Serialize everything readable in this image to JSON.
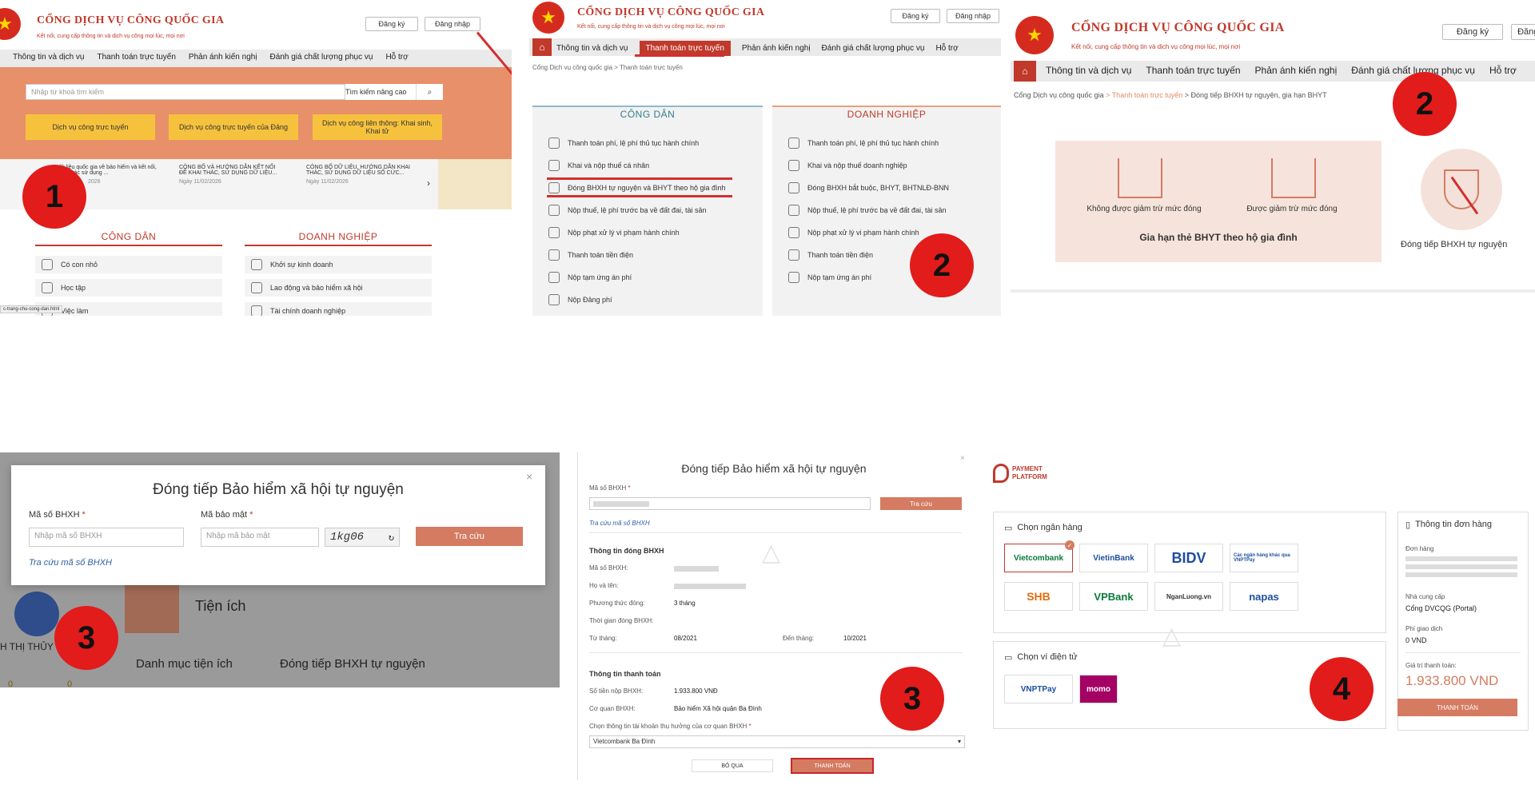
{
  "colors": {
    "brand": "#c0392b",
    "callout": "#e21b1b",
    "accent": "#d47b62"
  },
  "portal": {
    "title": "CỔNG DỊCH VỤ CÔNG QUỐC GIA",
    "subtitle": "Kết nối, cung cấp thông tin và dịch vụ công mọi lúc, mọi nơi",
    "register": "Đăng ký",
    "login": "Đăng nhập",
    "nav": [
      "Thông tin và dịch vụ",
      "Thanh toán trực tuyến",
      "Phản ánh kiến nghị",
      "Đánh giá chất lượng phục vụ",
      "Hỗ trợ"
    ]
  },
  "p1": {
    "search_placeholder": "Nhập từ khoá tìm kiếm",
    "advanced": "Tìm kiếm nâng cao",
    "quick": [
      "Dịch vụ công trực tuyến",
      "Dịch vụ công trực tuyến của Đảng",
      "Dịch vụ công liên thông: Khai sinh, Khai tử"
    ],
    "news": [
      {
        "title": "dữ liệu quốc gia về bảo hiểm và kết nối, khai thác sử dụng ...",
        "date": "2026"
      },
      {
        "title": "CÔNG BỐ VÀ HƯỚNG DẪN KẾT NỐI ĐỂ KHAI THÁC, SỬ DỤNG DỮ LIỆU...",
        "date": "Ngày 11/02/2026"
      },
      {
        "title": "CÔNG BỐ DỮ LIỆU, HƯỚNG DẪN KHAI THÁC, SỬ DỤNG DỮ LIỆU SỐ CỨC...",
        "date": "Ngày 11/02/2026"
      }
    ],
    "citizen": "CÔNG DÂN",
    "business": "DOANH NGHIỆP",
    "citizen_items": [
      "Có con nhỏ",
      "Học tập",
      "Việc làm"
    ],
    "business_items": [
      "Khởi sự kinh doanh",
      "Lao động và bảo hiểm xã hội",
      "Tài chính doanh nghiệp"
    ],
    "status_url": "c-trang-chu-cong-dan.html",
    "callout": "1"
  },
  "p2": {
    "breadcrumb": "Cổng Dịch vụ công quốc gia  >  Thanh toán trực tuyến",
    "citizen": "CÔNG DÂN",
    "business": "DOANH NGHIỆP",
    "citizen_items": [
      "Thanh toán phí, lệ phí thủ tục hành chính",
      "Khai và nộp thuế cá nhân",
      "Đóng BHXH tự nguyện và BHYT theo hộ gia đình",
      "Nộp thuế, lệ phí trước bạ về đất đai, tài sản",
      "Nộp phạt xử lý vi phạm hành chính",
      "Thanh toán tiền điện",
      "Nộp tạm ứng án phí",
      "Nộp Đảng phí"
    ],
    "business_items": [
      "Thanh toán phí, lệ phí thủ tục hành chính",
      "Khai và nộp thuế doanh nghiệp",
      "Đóng BHXH bắt buộc, BHYT, BHTNLĐ-BNN",
      "Nộp thuế, lệ phí trước bạ về đất đai, tài sản",
      "Nộp phạt xử lý vi phạm hành chính",
      "Thanh toán tiền điện",
      "Nộp tạm ứng án phí"
    ],
    "callout": "2"
  },
  "p3": {
    "breadcrumb_home": "Cổng Dịch vụ công quốc gia",
    "breadcrumb_mid": "Thanh toán trực tuyến",
    "breadcrumb_last": "Đóng tiếp BHXH tự nguyện, gia hạn BHYT",
    "opt1": "Không được giảm trừ mức đóng",
    "opt2": "Được giảm trừ mức đóng",
    "group": "Gia hạn thẻ BHYT theo hộ gia đình",
    "opt3": "Đóng tiếp BHXH tự nguyện",
    "callout": "2"
  },
  "p4": {
    "title": "Đóng tiếp Bảo hiểm xã hội tự nguyện",
    "label_bhxh": "Mã số BHXH",
    "label_captcha": "Mã bảo mật",
    "ph_bhxh": "Nhập mã số BHXH",
    "ph_captcha": "Nhập mã bảo mật",
    "captcha": "1kg06",
    "lookup_btn": "Tra cứu",
    "lookup_link": "Tra cứu mã số BHXH",
    "user_name": "H THỊ THỦY",
    "utility": "Tiện ích",
    "menu": "Danh mục tiện ích",
    "menu2": "Đóng tiếp BHXH tự nguyện",
    "counts": [
      "0",
      "0"
    ],
    "callout": "3"
  },
  "p5": {
    "title": "Đóng tiếp Bảo hiểm xã hội tự nguyện",
    "label_bhxh": "Mã số BHXH",
    "lookup_btn": "Tra cứu",
    "lookup_link": "Tra cứu mã số BHXH",
    "sec1": "Thông tin đóng BHXH",
    "f_code": "Mã số BHXH:",
    "f_name": "Họ và tên:",
    "f_method": "Phương thức đóng:",
    "v_method": "3 tháng",
    "f_period": "Thời gian đóng BHXH:",
    "f_from": "Từ tháng:",
    "v_from": "08/2021",
    "f_to": "Đến tháng:",
    "v_to": "10/2021",
    "sec2": "Thông tin thanh toán",
    "f_amount": "Số tiền nộp BHXH:",
    "v_amount": "1.933.800 VNĐ",
    "f_agency": "Cơ quan BHXH:",
    "v_agency": "Bảo hiểm Xã hội quận Ba Đình",
    "f_account": "Chọn thông tin tài khoản thụ hưởng của cơ quan BHXH",
    "v_account": "Vietcombank Ba Đình",
    "cancel": "BỎ QUA",
    "pay": "THANH TOÁN",
    "callout": "3"
  },
  "p6": {
    "brand_top": "PAYMENT",
    "brand_bottom": "PLATFORM",
    "choose_bank": "Chọn ngân hàng",
    "banks": [
      "Vietcombank",
      "VietinBank",
      "BIDV",
      "Các ngân hàng khác qua VNPTPay",
      "SHB",
      "VPBank",
      "NganLuong.vn",
      "napas"
    ],
    "choose_wallet": "Chọn ví điện tử",
    "wallets": [
      "VNPTPay",
      "momo"
    ],
    "order_title": "Thông tin đơn hàng",
    "f_order": "Đơn hàng",
    "f_provider": "Nhà cung cấp",
    "v_provider": "Cổng DVCQG (Portal)",
    "f_fee": "Phí giao dịch",
    "v_fee": "0 VND",
    "f_total": "Giá trị thanh toán:",
    "v_total": "1.933.800 VND",
    "pay": "THANH TOÁN",
    "callout": "4"
  }
}
